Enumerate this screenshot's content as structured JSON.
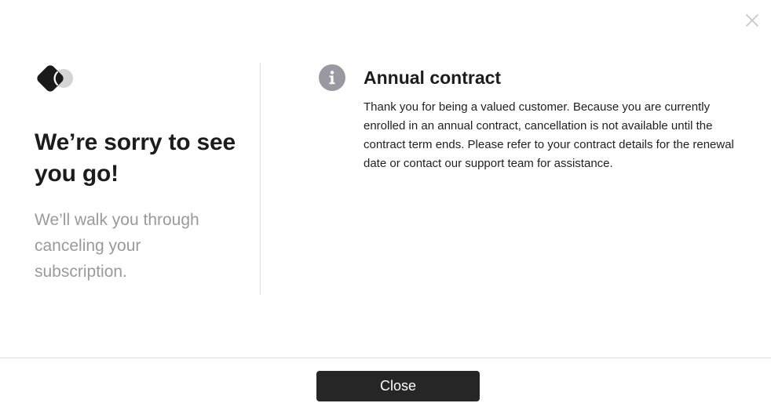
{
  "left": {
    "title": "We’re sorry to see you go!",
    "subtitle": "We’ll walk you through canceling your subscription."
  },
  "notice": {
    "icon": "info-icon",
    "title": "Annual contract",
    "body": "Thank you for being a valued customer. Because you are currently enrolled in an annual contract, cancellation is not available until the contract term ends. Please refer to your contract details for the renewal date or contact our support team for assistance."
  },
  "footer": {
    "close_label": "Close"
  },
  "icons": {
    "dismiss": "close-icon",
    "brand": "logo-icon"
  },
  "colors": {
    "primary_button": "#262626",
    "subtitle_text": "#9a9a9e",
    "info_icon_bg": "#9a99a0"
  }
}
